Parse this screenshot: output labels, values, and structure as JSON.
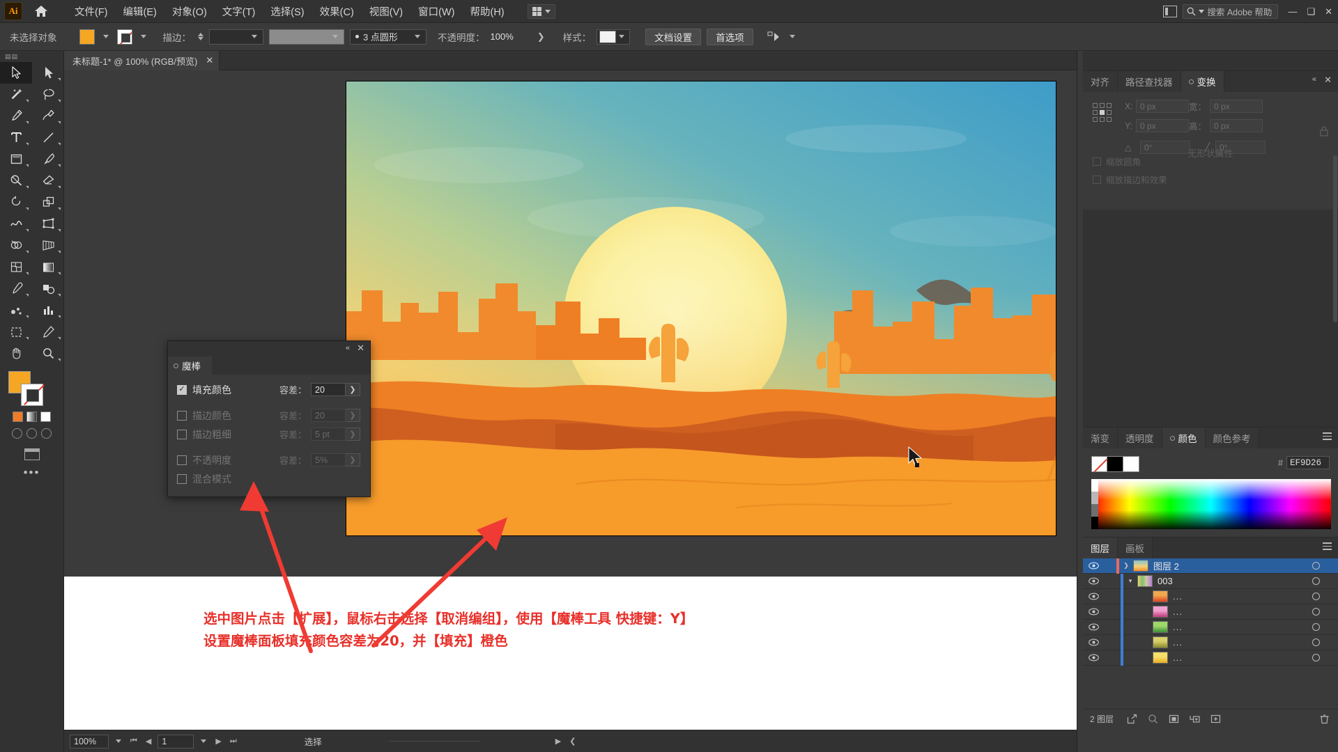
{
  "app": {
    "logo_text": "Ai",
    "title_tab": "未标题-1* @ 100% (RGB/预览)",
    "search_placeholder": "搜索 Adobe 帮助"
  },
  "menubar": {
    "items": [
      {
        "label": "文件(F)"
      },
      {
        "label": "编辑(E)"
      },
      {
        "label": "对象(O)"
      },
      {
        "label": "文字(T)"
      },
      {
        "label": "选择(S)"
      },
      {
        "label": "效果(C)"
      },
      {
        "label": "视图(V)"
      },
      {
        "label": "窗口(W)"
      },
      {
        "label": "帮助(H)"
      }
    ]
  },
  "optionsbar": {
    "selection_status": "未选择对象",
    "fill_color": "#F5A623",
    "stroke_label": "描边：",
    "stroke_weight": "",
    "stroke_profile": "",
    "brush_def": "3 点圆形",
    "opacity_label": "不透明度：",
    "opacity_value": "100%",
    "style_label": "样式：",
    "doc_setup_button": "文档设置",
    "preferences_button": "首选项"
  },
  "magic_wand_panel": {
    "tab_label": "魔棒",
    "rows": [
      {
        "label": "填充颜色",
        "checked": true,
        "tol_label": "容差：",
        "tol_value": "20",
        "enabled": true
      },
      {
        "label": "描边颜色",
        "checked": false,
        "tol_label": "容差：",
        "tol_value": "20",
        "enabled": false
      },
      {
        "label": "描边粗细",
        "checked": false,
        "tol_label": "容差：",
        "tol_value": "5 pt",
        "enabled": false
      },
      {
        "label": "不透明度",
        "checked": false,
        "tol_label": "容差：",
        "tol_value": "5%",
        "enabled": false
      },
      {
        "label": "混合模式",
        "checked": false,
        "tol_label": "",
        "tol_value": "",
        "enabled": false
      }
    ]
  },
  "transform_panel": {
    "tabs": [
      {
        "label": "对齐",
        "active": false
      },
      {
        "label": "路径查找器",
        "active": false
      },
      {
        "label": "变换",
        "active": true
      }
    ],
    "fields": [
      {
        "label": "X:",
        "value": "0 px"
      },
      {
        "label": "宽：",
        "value": "0 px"
      },
      {
        "label": "Y:",
        "value": "0 px"
      },
      {
        "label": "高：",
        "value": "0 px"
      }
    ],
    "angle_value": "0°",
    "shear_value": "0°",
    "empty_text": "无形状属性",
    "checks": [
      {
        "label": "缩放圆角"
      },
      {
        "label": "缩放描边和效果"
      }
    ]
  },
  "color_panel": {
    "tabs": [
      {
        "label": "渐变",
        "active": false
      },
      {
        "label": "透明度",
        "active": false
      },
      {
        "label": "颜色",
        "active": true
      },
      {
        "label": "颜色参考",
        "active": false
      }
    ],
    "hash_symbol": "#",
    "hex_value": "EF9D26"
  },
  "layers_panel": {
    "tabs": [
      {
        "label": "图层",
        "active": true
      },
      {
        "label": "画板",
        "active": false
      }
    ],
    "rows": [
      {
        "name": "图层 2",
        "selected": true,
        "indent": 0,
        "color": "#e86b5a",
        "thumb": "artwork",
        "expander": "collapsed"
      },
      {
        "name": "003",
        "selected": false,
        "indent": 1,
        "color": "#3f7fd4",
        "thumb": "group",
        "expander": "expanded"
      },
      {
        "name": "...",
        "selected": false,
        "indent": 2,
        "color": "#3f7fd4",
        "thumb": "sw-orange",
        "expander": "none"
      },
      {
        "name": "...",
        "selected": false,
        "indent": 2,
        "color": "#3f7fd4",
        "thumb": "sw-pink",
        "expander": "none"
      },
      {
        "name": "...",
        "selected": false,
        "indent": 2,
        "color": "#3f7fd4",
        "thumb": "sw-green",
        "expander": "none"
      },
      {
        "name": "...",
        "selected": false,
        "indent": 2,
        "color": "#3f7fd4",
        "thumb": "sw-olive",
        "expander": "none"
      },
      {
        "name": "...",
        "selected": false,
        "indent": 2,
        "color": "#3f7fd4",
        "thumb": "sw-yellow",
        "expander": "none"
      }
    ],
    "footer_count": "2 图层"
  },
  "statusbar": {
    "zoom": "100%",
    "page": "1",
    "tool_status": "选择"
  },
  "caption": {
    "line1": "选中图片点击【扩展】，鼠标右击选择【取消编组】，使用【魔棒工具 快捷键：Y】",
    "line2": "设置魔棒面板填充颜色容差为20，并【填充】橙色",
    "color": "#E8302A"
  },
  "toolbar": {
    "tools": [
      {
        "name": "selection-tool",
        "active": true
      },
      {
        "name": "direct-selection-tool",
        "active": false
      },
      {
        "name": "magic-wand-tool",
        "active": false
      },
      {
        "name": "lasso-tool",
        "active": false
      },
      {
        "name": "pen-tool",
        "active": false
      },
      {
        "name": "curvature-tool",
        "active": false
      },
      {
        "name": "type-tool",
        "active": false
      },
      {
        "name": "line-segment-tool",
        "active": false
      },
      {
        "name": "rectangle-tool",
        "active": false
      },
      {
        "name": "paintbrush-tool",
        "active": false
      },
      {
        "name": "shaper-tool",
        "active": false
      },
      {
        "name": "eraser-tool",
        "active": false
      },
      {
        "name": "rotate-tool",
        "active": false
      },
      {
        "name": "scale-tool",
        "active": false
      },
      {
        "name": "width-tool",
        "active": false
      },
      {
        "name": "free-transform-tool",
        "active": false
      },
      {
        "name": "shape-builder-tool",
        "active": false
      },
      {
        "name": "perspective-grid-tool",
        "active": false
      },
      {
        "name": "mesh-tool",
        "active": false
      },
      {
        "name": "gradient-tool",
        "active": false
      },
      {
        "name": "eyedropper-tool",
        "active": false
      },
      {
        "name": "blend-tool",
        "active": false
      }
    ],
    "fill_color": "#F5A623",
    "more_tools": "•••"
  },
  "artwork": {
    "title": "desert-sunset-illustration",
    "sky_top": "#4FA3C7",
    "sky_mid": "#8FC4B9",
    "sky_low": "#F0D98A",
    "sun": "#FCF3A8",
    "dune_front": "#F59A2E",
    "dune_mid": "#E8792A",
    "dune_dark": "#C75A22",
    "cactus": "#F5A33A"
  }
}
